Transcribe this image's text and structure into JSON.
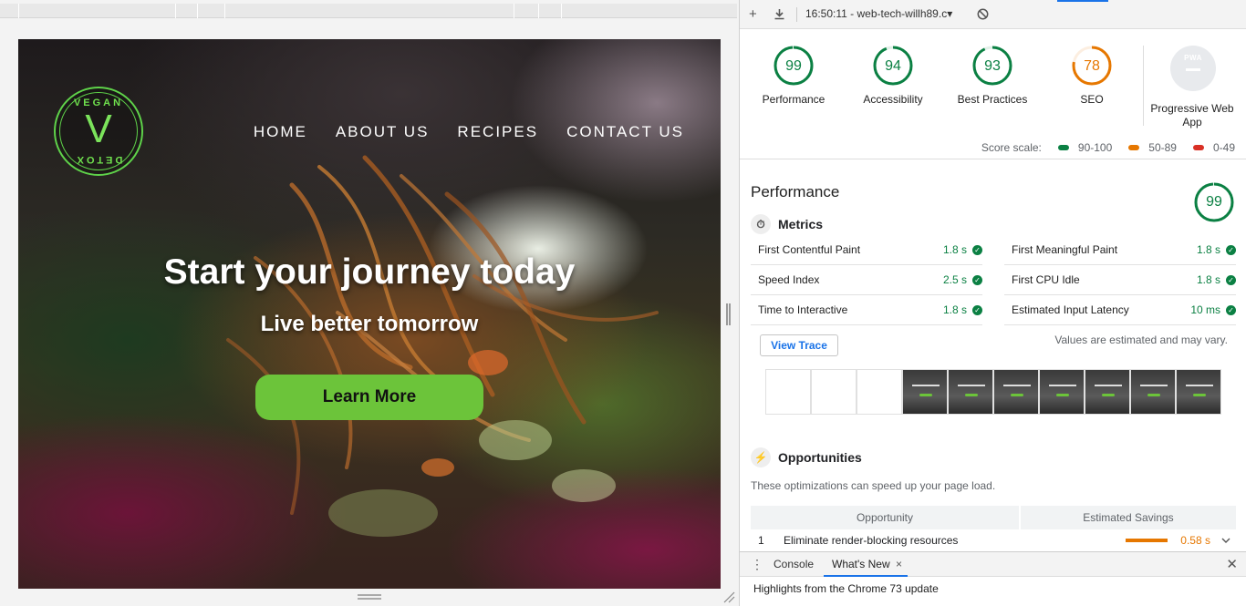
{
  "site": {
    "logo_top": "VEGAN",
    "logo_letter": "V",
    "logo_bottom": "DETOX",
    "nav": [
      "HOME",
      "ABOUT US",
      "RECIPES",
      "CONTACT US"
    ],
    "hero_title": "Start your journey today",
    "hero_subtitle": "Live better tomorrow",
    "cta": "Learn More"
  },
  "devtools": {
    "toolbar": {
      "add_icon": "plus-icon",
      "download_icon": "download-icon",
      "report_selector": "16:50:11 - web-tech-willh89.c▾",
      "clear_icon": "block-icon"
    },
    "categories": [
      {
        "label": "Performance",
        "score": 99,
        "color": "#0b8043"
      },
      {
        "label": "Accessibility",
        "score": 94,
        "color": "#0b8043"
      },
      {
        "label": "Best Practices",
        "score": 93,
        "color": "#0b8043"
      },
      {
        "label": "SEO",
        "score": 78,
        "color": "#e67700"
      }
    ],
    "pwa": {
      "badge": "PWA",
      "label": "Progressive Web App"
    },
    "score_scale": {
      "label": "Score scale:",
      "ranges": [
        {
          "range": "90-100",
          "color": "#0b8043"
        },
        {
          "range": "50-89",
          "color": "#e67700"
        },
        {
          "range": "0-49",
          "color": "#d93025"
        }
      ]
    },
    "performance": {
      "title": "Performance",
      "score": 99,
      "metrics_title": "Metrics",
      "metrics": [
        {
          "name": "First Contentful Paint",
          "value": "1.8 s"
        },
        {
          "name": "First Meaningful Paint",
          "value": "1.8 s"
        },
        {
          "name": "Speed Index",
          "value": "2.5 s"
        },
        {
          "name": "First CPU Idle",
          "value": "1.8 s"
        },
        {
          "name": "Time to Interactive",
          "value": "1.8 s"
        },
        {
          "name": "Estimated Input Latency",
          "value": "10 ms"
        }
      ],
      "view_trace": "View Trace",
      "estimate_note": "Values are estimated and may vary."
    },
    "opportunities": {
      "title": "Opportunities",
      "description": "These optimizations can speed up your page load.",
      "col_opportunity": "Opportunity",
      "col_savings": "Estimated Savings",
      "rows": [
        {
          "index": "1",
          "name": "Eliminate render-blocking resources",
          "savings": "0.58 s"
        }
      ]
    },
    "drawer": {
      "tabs": [
        "Console",
        "What's New"
      ],
      "close_tab": "×",
      "close": "✕",
      "message": "Highlights from the Chrome 73 update"
    }
  }
}
